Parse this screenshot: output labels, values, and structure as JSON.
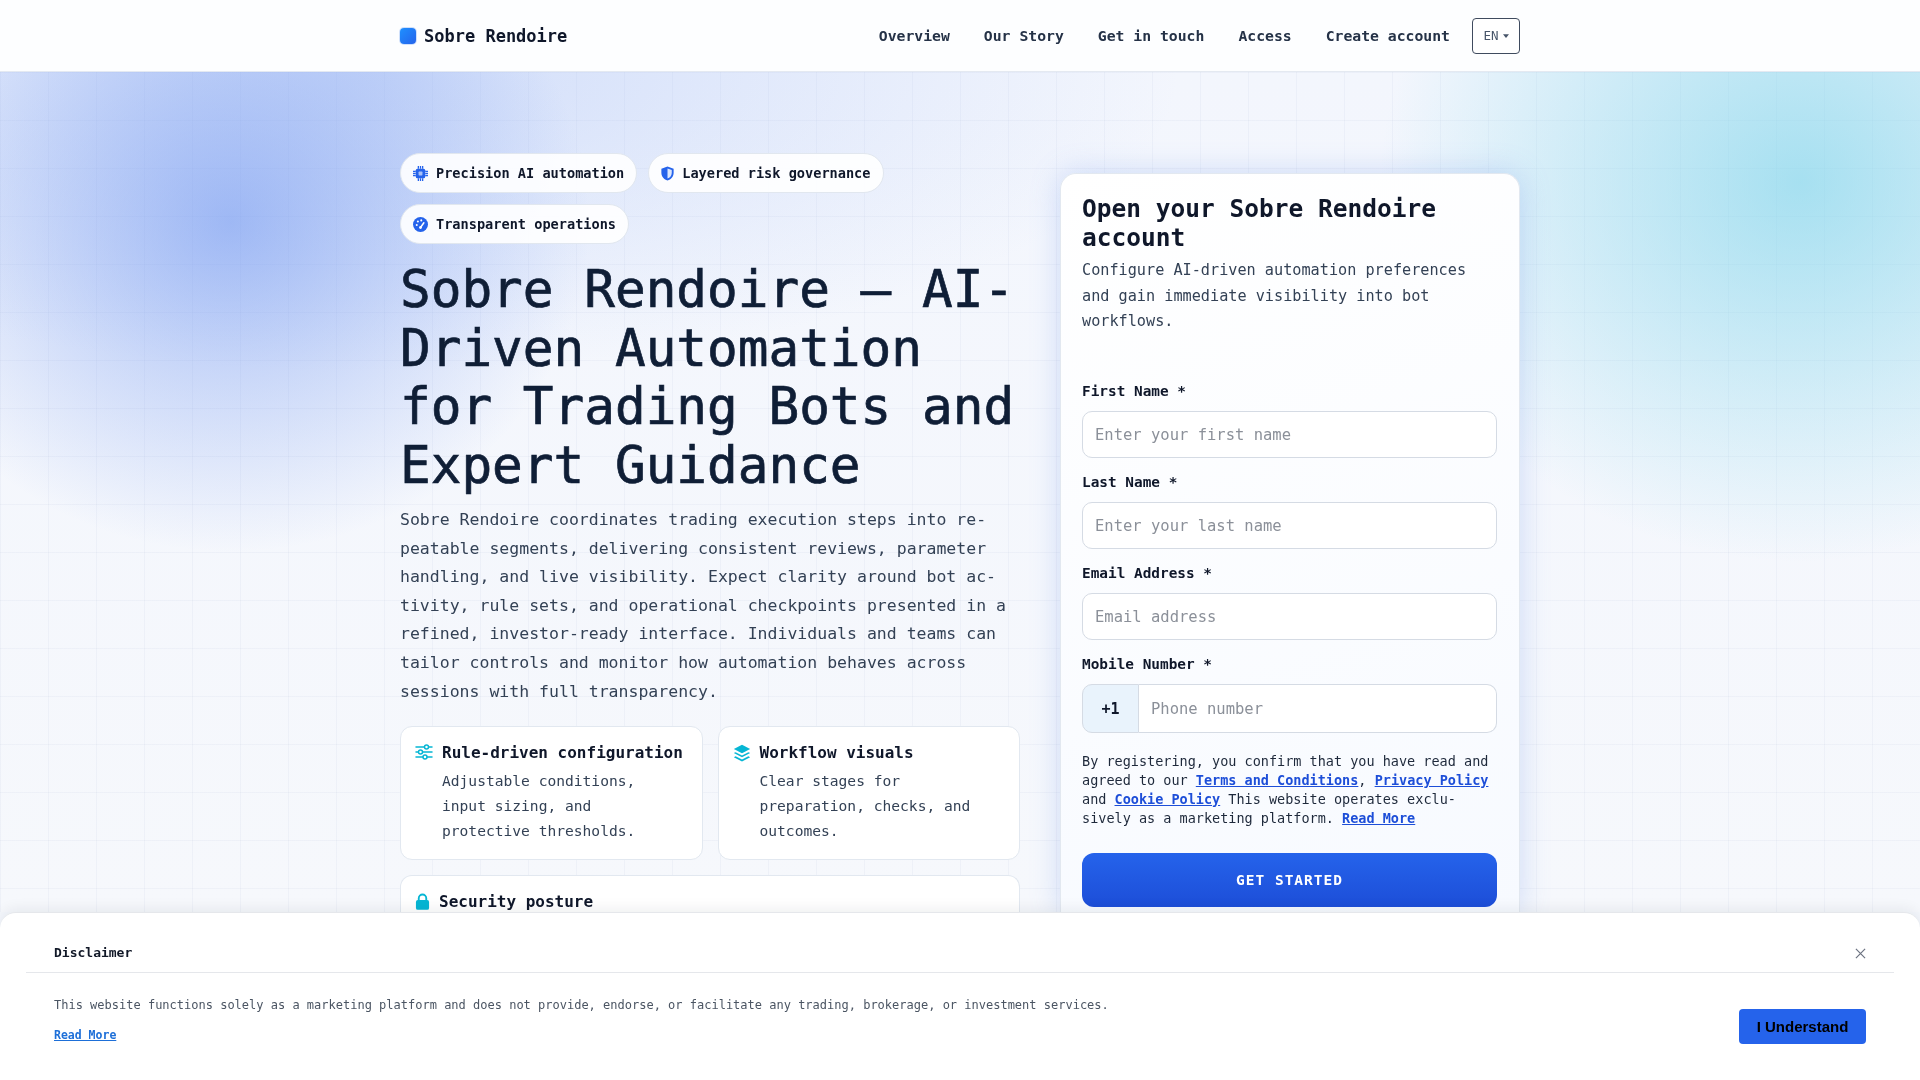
{
  "header": {
    "brand": "Sobre Rendoire",
    "nav": [
      {
        "label": "Overview"
      },
      {
        "label": "Our Story"
      },
      {
        "label": "Get in touch"
      },
      {
        "label": "Access"
      },
      {
        "label": "Create account"
      }
    ],
    "language": "EN"
  },
  "hero": {
    "badges": [
      {
        "label": "Precision AI automation"
      },
      {
        "label": "Layered risk governance"
      },
      {
        "label": "Transparent operations"
      }
    ],
    "title": "Sobre Rendoire — AI-Driven Automation for Trading Bots and Expert Guidance",
    "intro": "Sobre Rendoire coordinates trading execution steps into re-peatable segments, delivering consistent reviews, parameter handling, and live visibility. Expect clarity around bot ac-tivity, rule sets, and operational checkpoints presented in a refined, investor-ready interface. Individuals and teams can tailor controls and monitor how automation behaves across sessions with full transparency.",
    "features": [
      {
        "title": "Rule-driven configuration",
        "description": "Adjustable conditions, input sizing, and protective thresholds."
      },
      {
        "title": "Workflow visuals",
        "description": "Clear stages for preparation, checks, and outcomes."
      },
      {
        "title": "Security posture"
      }
    ]
  },
  "signup": {
    "title": "Open your Sobre Rendoire account",
    "description": "Configure AI-driven automation preferences and gain immediate visibility into bot workflows.",
    "fields": [
      {
        "kind": "text",
        "label": "First Name *",
        "placeholder": "Enter your first name"
      },
      {
        "kind": "text",
        "label": "Last Name *",
        "placeholder": "Enter your last name"
      },
      {
        "kind": "text",
        "label": "Email Address *",
        "placeholder": "Email address"
      },
      {
        "kind": "phone",
        "label": "Mobile Number *",
        "prefix": "+1",
        "placeholder": "Phone number"
      }
    ],
    "consent": [
      {
        "kind": "text",
        "text": "By registering, you confirm that you have read and agreed to our "
      },
      {
        "kind": "link",
        "text": "Terms and Conditions"
      },
      {
        "kind": "text",
        "text": ", "
      },
      {
        "kind": "link",
        "text": "Privacy Policy"
      },
      {
        "kind": "text",
        "text": " and "
      },
      {
        "kind": "link",
        "text": "Cookie Policy"
      },
      {
        "kind": "text",
        "text": " This website operates exclu-sively as a marketing platform. "
      },
      {
        "kind": "link",
        "text": "Read More"
      }
    ],
    "button": "GET STARTED"
  },
  "disclaimer": {
    "title": "Disclaimer",
    "text": "This website functions solely as a marketing platform and does not provide, endorse, or facilitate any trading, brokerage, or investment services.",
    "link": "Read More",
    "button": "I Understand"
  }
}
